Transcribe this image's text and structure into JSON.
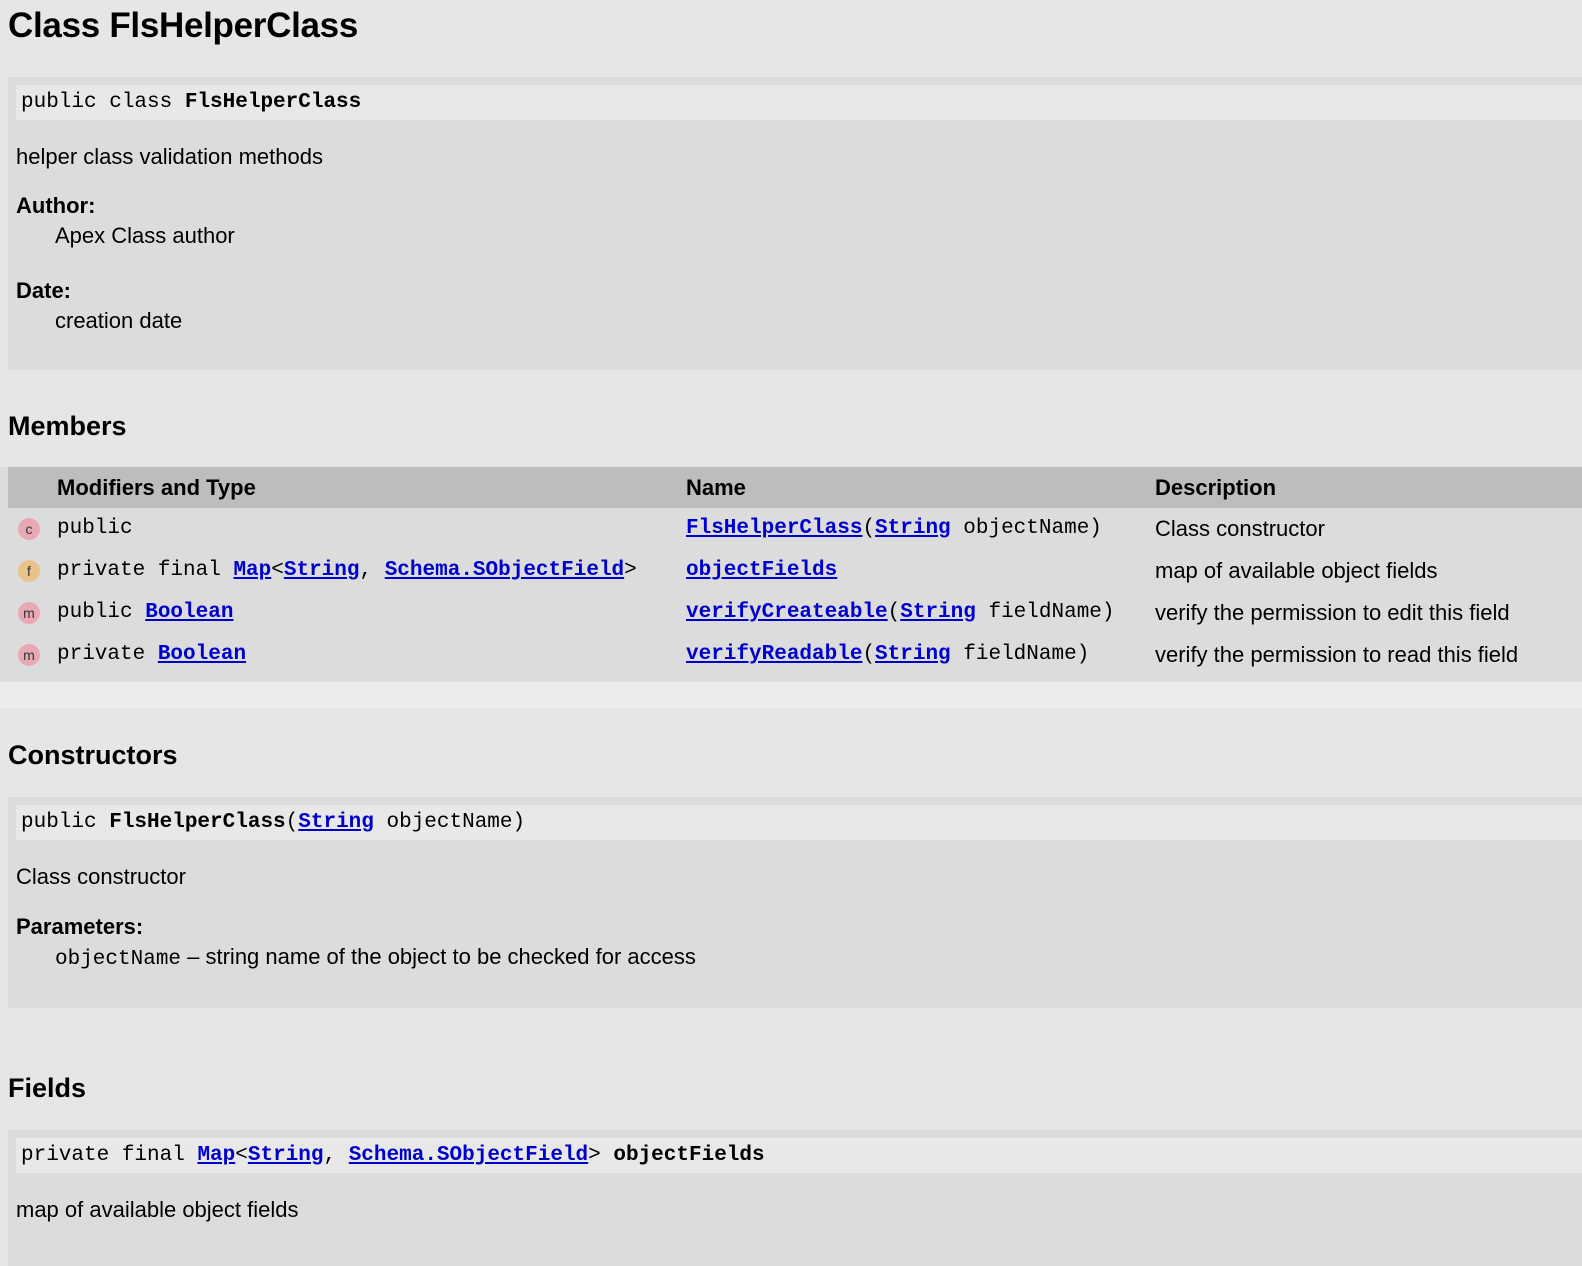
{
  "page": {
    "title": "Class FlsHelperClass"
  },
  "class_panel": {
    "sig_prefix": "public class ",
    "sig_name": "FlsHelperClass",
    "description": "helper class validation methods",
    "author_label": "Author:",
    "author_value": "Apex Class author",
    "date_label": "Date:",
    "date_value": "creation date"
  },
  "members": {
    "heading": "Members",
    "columns": {
      "modifiers": "Modifiers and Type",
      "name": "Name",
      "description": "Description"
    },
    "rows": [
      {
        "badge": "c",
        "badge_color": "#e8a9b4",
        "mod_text": "public",
        "name_link": "FlsHelperClass",
        "name_open": "(",
        "param_type": "String",
        "param_name": " objectName)",
        "description": "Class constructor"
      },
      {
        "badge": "f",
        "badge_color": "#e8c48a",
        "mod_prefix": "private final ",
        "mod_type_link": "Map",
        "mod_lt": "<",
        "mod_arg1": "String",
        "mod_comma": ", ",
        "mod_arg2": "Schema.SObjectField",
        "mod_gt": ">",
        "name_link": "objectFields",
        "description": "map of available object fields"
      },
      {
        "badge": "m",
        "badge_color": "#e8a9b4",
        "mod_prefix": "public ",
        "mod_type_link": "Boolean",
        "name_link": "verifyCreateable",
        "name_open": "(",
        "param_type": "String",
        "param_name": " fieldName)",
        "description": "verify the permission to edit this field"
      },
      {
        "badge": "m",
        "badge_color": "#e8a9b4",
        "mod_prefix": "private ",
        "mod_type_link": "Boolean",
        "name_link": "verifyReadable",
        "name_open": "(",
        "param_type": "String",
        "param_name": " fieldName)",
        "description": "verify the permission to read this field"
      }
    ]
  },
  "constructors": {
    "heading": "Constructors",
    "sig_prefix": "public ",
    "sig_name": "FlsHelperClass",
    "sig_open": "(",
    "sig_param_type": "String",
    "sig_param_rest": " objectName)",
    "description": "Class constructor",
    "params_label": "Parameters:",
    "param_name": "objectName",
    "param_desc": " – string name of the object to be checked for access"
  },
  "fields": {
    "heading": "Fields",
    "sig_prefix": "private final ",
    "sig_type": "Map",
    "sig_lt": "<",
    "sig_arg1": "String",
    "sig_comma": ", ",
    "sig_arg2": "Schema.SObjectField",
    "sig_gt": "> ",
    "sig_name": "objectFields",
    "description": "map of available object fields"
  }
}
